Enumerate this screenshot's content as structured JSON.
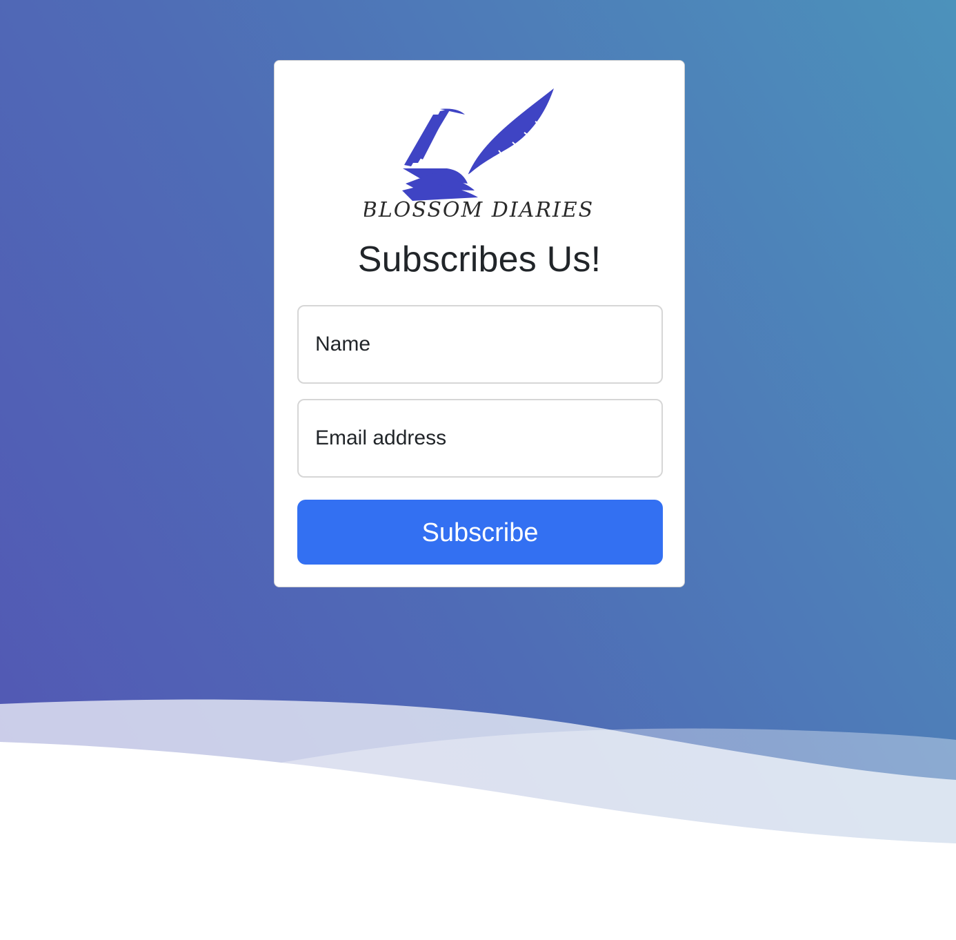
{
  "brand": {
    "logo_text": "BLOSSOM  DIARIES",
    "logo_icon": "book-quill-logo",
    "logo_color": "#3f44c4"
  },
  "form": {
    "title": "Subscribes Us!",
    "name_placeholder": "Name",
    "email_placeholder": "Email address",
    "submit_label": "Subscribe"
  },
  "colors": {
    "gradient_start": "#5355b4",
    "gradient_end": "#4c92bb",
    "button": "#3370f2",
    "text": "#212529"
  }
}
